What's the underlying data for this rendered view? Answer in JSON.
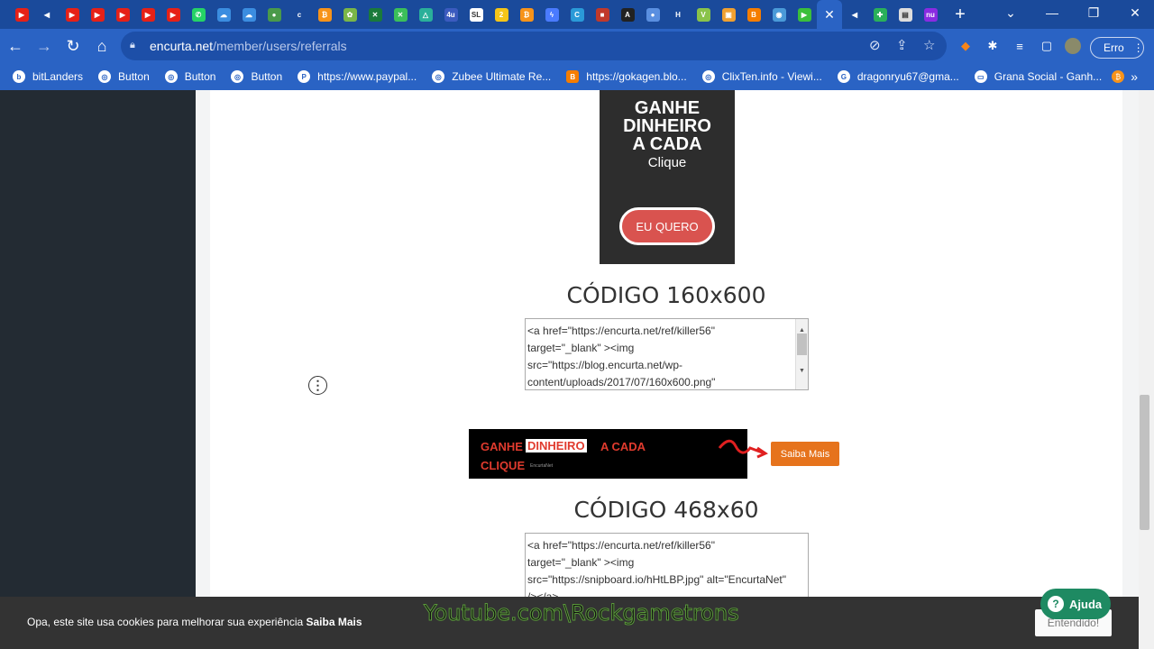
{
  "tabs": [
    {
      "icon": "youtube-icon",
      "color": "#e62117",
      "glyph": "▶"
    },
    {
      "icon": "speaker-icon",
      "color": "#1a4a9b",
      "glyph": "◀"
    },
    {
      "icon": "youtube-icon",
      "color": "#e62117",
      "glyph": "▶"
    },
    {
      "icon": "youtube-icon",
      "color": "#e62117",
      "glyph": "▶"
    },
    {
      "icon": "youtube-icon",
      "color": "#e62117",
      "glyph": "▶"
    },
    {
      "icon": "youtube-icon",
      "color": "#e62117",
      "glyph": "▶"
    },
    {
      "icon": "youtube-icon",
      "color": "#e62117",
      "glyph": "▶"
    },
    {
      "icon": "whatsapp-icon",
      "color": "#25d366",
      "glyph": "✆"
    },
    {
      "icon": "cloud-icon",
      "color": "#3b8de0",
      "glyph": "☁"
    },
    {
      "icon": "cloud-icon",
      "color": "#3b8de0",
      "glyph": "☁"
    },
    {
      "icon": "globe-icon",
      "color": "#4a9a4a",
      "glyph": "●"
    },
    {
      "icon": "c-icon",
      "color": "#1a4a9b",
      "glyph": "c"
    },
    {
      "icon": "bitcoin-icon",
      "color": "#f7931a",
      "glyph": "₿"
    },
    {
      "icon": "flower-icon",
      "color": "#7ab648",
      "glyph": "✿"
    },
    {
      "icon": "x-icon",
      "color": "#1a7a3a",
      "glyph": "✕"
    },
    {
      "icon": "x-icon",
      "color": "#3bbf5a",
      "glyph": "✕"
    },
    {
      "icon": "triangle-icon",
      "color": "#2ab09a",
      "glyph": "△"
    },
    {
      "icon": "4u-icon",
      "color": "#3b5bbf",
      "glyph": "4u"
    },
    {
      "icon": "sl-icon",
      "color": "#ffffff",
      "glyph": "SL"
    },
    {
      "icon": "coin-icon",
      "color": "#f5c518",
      "glyph": "2"
    },
    {
      "icon": "bitcoin-icon",
      "color": "#f7931a",
      "glyph": "₿"
    },
    {
      "icon": "bolt-icon",
      "color": "#4a7bff",
      "glyph": "ϟ"
    },
    {
      "icon": "c-icon",
      "color": "#2a9ad8",
      "glyph": "C"
    },
    {
      "icon": "red-icon",
      "color": "#c0392b",
      "glyph": "■"
    },
    {
      "icon": "a-icon",
      "color": "#222222",
      "glyph": "A"
    },
    {
      "icon": "bubble-icon",
      "color": "#5a8fe0",
      "glyph": "●"
    },
    {
      "icon": "h-icon",
      "color": "#1a4a9b",
      "glyph": "H"
    },
    {
      "icon": "v-icon",
      "color": "#8ac34a",
      "glyph": "V"
    },
    {
      "icon": "box-icon",
      "color": "#f0a030",
      "glyph": "▣"
    },
    {
      "icon": "blogger-icon",
      "color": "#f57d00",
      "glyph": "B"
    },
    {
      "icon": "eye-icon",
      "color": "#4a9ad8",
      "glyph": "◉"
    },
    {
      "icon": "play-icon",
      "color": "#3bbf3b",
      "glyph": "▶"
    }
  ],
  "active_tab": {
    "icon": "close-icon",
    "glyph": "✕"
  },
  "tabs_after": [
    {
      "icon": "speaker-icon",
      "color": "#1a4a9b",
      "glyph": "◀"
    },
    {
      "icon": "gift-icon",
      "color": "#2ab05a",
      "glyph": "✚"
    },
    {
      "icon": "doc-icon",
      "color": "#dddddd",
      "glyph": "▤"
    },
    {
      "icon": "nu-icon",
      "color": "#8a2be2",
      "glyph": "nu"
    }
  ],
  "newtab_glyph": "+",
  "window": {
    "min": "—",
    "restore": "❐",
    "close": "✕",
    "dropdown": "⌄"
  },
  "url": {
    "host": "encurta.net",
    "path": "/member/users/referrals"
  },
  "error_button": "Erro",
  "bookmarks": [
    {
      "icon": "bitlanders-icon",
      "label": "bitLanders"
    },
    {
      "icon": "globe-icon",
      "label": "Button"
    },
    {
      "icon": "globe-icon",
      "label": "Button"
    },
    {
      "icon": "globe-icon",
      "label": "Button"
    },
    {
      "icon": "paypal-icon",
      "label": "https://www.paypal..."
    },
    {
      "icon": "globe-icon",
      "label": "Zubee Ultimate Re..."
    },
    {
      "icon": "blogger-icon",
      "label": "https://gokagen.blo..."
    },
    {
      "icon": "globe-icon",
      "label": "ClixTen.info - Viewi..."
    },
    {
      "icon": "google-icon",
      "label": "dragonryu67@gma..."
    },
    {
      "icon": "card-icon",
      "label": "Grana Social - Ganh..."
    }
  ],
  "banner160": {
    "line1": "GANHE",
    "line2": "DINHEIRO",
    "line3": "A CADA",
    "click": "Clique",
    "button": "EU QUERO"
  },
  "code160": {
    "heading": "CÓDIGO 160x600",
    "lines": [
      "<a href=\"https://encurta.net/ref/killer56\"",
      "target=\"_blank\" ><img",
      "src=\"https://blog.encurta.net/wp-",
      "content/uploads/2017/07/160x600.png\""
    ]
  },
  "banner468": {
    "ganhe": "GANHE",
    "dinheiro": "DINHEIRO",
    "acada": "A CADA",
    "clique": "CLIQUE",
    "logo": "EncurtaNet",
    "button": "Saiba Mais"
  },
  "code468": {
    "heading": "CÓDIGO 468x60",
    "lines": [
      "<a href=\"https://encurta.net/ref/killer56\"",
      "target=\"_blank\" ><img",
      "src=\"https://snipboard.io/hHtLBP.jpg\" alt=\"EncurtaNet\"",
      "/></a>"
    ]
  },
  "cookie": {
    "text": "Opa, este site usa cookies para melhorar sua experiência ",
    "link": "Saiba Mais",
    "ok": "Entendido!"
  },
  "help": {
    "label": "Ajuda",
    "glyph": "?"
  },
  "watermark": "Youtube.com\\Rockgametrons"
}
